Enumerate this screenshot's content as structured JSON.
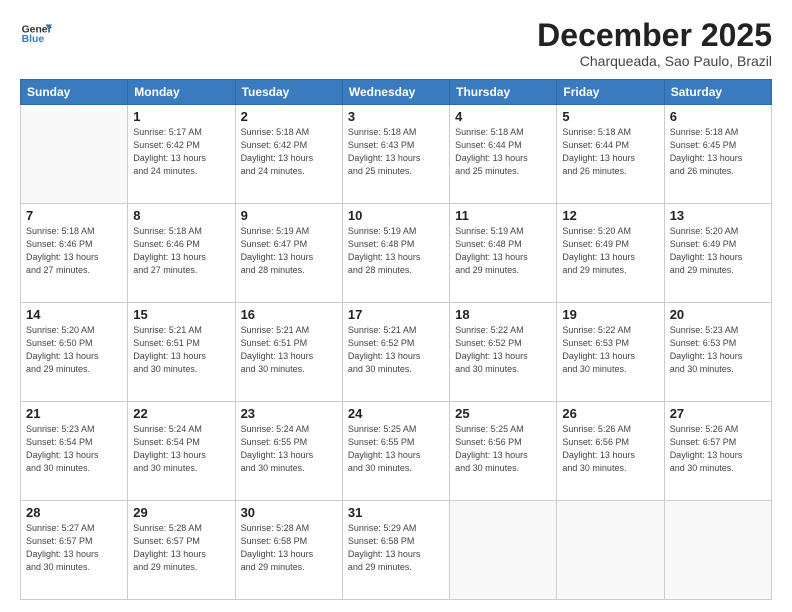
{
  "header": {
    "logo_line1": "General",
    "logo_line2": "Blue",
    "month": "December 2025",
    "location": "Charqueada, Sao Paulo, Brazil"
  },
  "days_of_week": [
    "Sunday",
    "Monday",
    "Tuesday",
    "Wednesday",
    "Thursday",
    "Friday",
    "Saturday"
  ],
  "weeks": [
    [
      {
        "day": "",
        "info": ""
      },
      {
        "day": "1",
        "info": "Sunrise: 5:17 AM\nSunset: 6:42 PM\nDaylight: 13 hours\nand 24 minutes."
      },
      {
        "day": "2",
        "info": "Sunrise: 5:18 AM\nSunset: 6:42 PM\nDaylight: 13 hours\nand 24 minutes."
      },
      {
        "day": "3",
        "info": "Sunrise: 5:18 AM\nSunset: 6:43 PM\nDaylight: 13 hours\nand 25 minutes."
      },
      {
        "day": "4",
        "info": "Sunrise: 5:18 AM\nSunset: 6:44 PM\nDaylight: 13 hours\nand 25 minutes."
      },
      {
        "day": "5",
        "info": "Sunrise: 5:18 AM\nSunset: 6:44 PM\nDaylight: 13 hours\nand 26 minutes."
      },
      {
        "day": "6",
        "info": "Sunrise: 5:18 AM\nSunset: 6:45 PM\nDaylight: 13 hours\nand 26 minutes."
      }
    ],
    [
      {
        "day": "7",
        "info": "Sunrise: 5:18 AM\nSunset: 6:46 PM\nDaylight: 13 hours\nand 27 minutes."
      },
      {
        "day": "8",
        "info": "Sunrise: 5:18 AM\nSunset: 6:46 PM\nDaylight: 13 hours\nand 27 minutes."
      },
      {
        "day": "9",
        "info": "Sunrise: 5:19 AM\nSunset: 6:47 PM\nDaylight: 13 hours\nand 28 minutes."
      },
      {
        "day": "10",
        "info": "Sunrise: 5:19 AM\nSunset: 6:48 PM\nDaylight: 13 hours\nand 28 minutes."
      },
      {
        "day": "11",
        "info": "Sunrise: 5:19 AM\nSunset: 6:48 PM\nDaylight: 13 hours\nand 29 minutes."
      },
      {
        "day": "12",
        "info": "Sunrise: 5:20 AM\nSunset: 6:49 PM\nDaylight: 13 hours\nand 29 minutes."
      },
      {
        "day": "13",
        "info": "Sunrise: 5:20 AM\nSunset: 6:49 PM\nDaylight: 13 hours\nand 29 minutes."
      }
    ],
    [
      {
        "day": "14",
        "info": "Sunrise: 5:20 AM\nSunset: 6:50 PM\nDaylight: 13 hours\nand 29 minutes."
      },
      {
        "day": "15",
        "info": "Sunrise: 5:21 AM\nSunset: 6:51 PM\nDaylight: 13 hours\nand 30 minutes."
      },
      {
        "day": "16",
        "info": "Sunrise: 5:21 AM\nSunset: 6:51 PM\nDaylight: 13 hours\nand 30 minutes."
      },
      {
        "day": "17",
        "info": "Sunrise: 5:21 AM\nSunset: 6:52 PM\nDaylight: 13 hours\nand 30 minutes."
      },
      {
        "day": "18",
        "info": "Sunrise: 5:22 AM\nSunset: 6:52 PM\nDaylight: 13 hours\nand 30 minutes."
      },
      {
        "day": "19",
        "info": "Sunrise: 5:22 AM\nSunset: 6:53 PM\nDaylight: 13 hours\nand 30 minutes."
      },
      {
        "day": "20",
        "info": "Sunrise: 5:23 AM\nSunset: 6:53 PM\nDaylight: 13 hours\nand 30 minutes."
      }
    ],
    [
      {
        "day": "21",
        "info": "Sunrise: 5:23 AM\nSunset: 6:54 PM\nDaylight: 13 hours\nand 30 minutes."
      },
      {
        "day": "22",
        "info": "Sunrise: 5:24 AM\nSunset: 6:54 PM\nDaylight: 13 hours\nand 30 minutes."
      },
      {
        "day": "23",
        "info": "Sunrise: 5:24 AM\nSunset: 6:55 PM\nDaylight: 13 hours\nand 30 minutes."
      },
      {
        "day": "24",
        "info": "Sunrise: 5:25 AM\nSunset: 6:55 PM\nDaylight: 13 hours\nand 30 minutes."
      },
      {
        "day": "25",
        "info": "Sunrise: 5:25 AM\nSunset: 6:56 PM\nDaylight: 13 hours\nand 30 minutes."
      },
      {
        "day": "26",
        "info": "Sunrise: 5:26 AM\nSunset: 6:56 PM\nDaylight: 13 hours\nand 30 minutes."
      },
      {
        "day": "27",
        "info": "Sunrise: 5:26 AM\nSunset: 6:57 PM\nDaylight: 13 hours\nand 30 minutes."
      }
    ],
    [
      {
        "day": "28",
        "info": "Sunrise: 5:27 AM\nSunset: 6:57 PM\nDaylight: 13 hours\nand 30 minutes."
      },
      {
        "day": "29",
        "info": "Sunrise: 5:28 AM\nSunset: 6:57 PM\nDaylight: 13 hours\nand 29 minutes."
      },
      {
        "day": "30",
        "info": "Sunrise: 5:28 AM\nSunset: 6:58 PM\nDaylight: 13 hours\nand 29 minutes."
      },
      {
        "day": "31",
        "info": "Sunrise: 5:29 AM\nSunset: 6:58 PM\nDaylight: 13 hours\nand 29 minutes."
      },
      {
        "day": "",
        "info": ""
      },
      {
        "day": "",
        "info": ""
      },
      {
        "day": "",
        "info": ""
      }
    ]
  ]
}
